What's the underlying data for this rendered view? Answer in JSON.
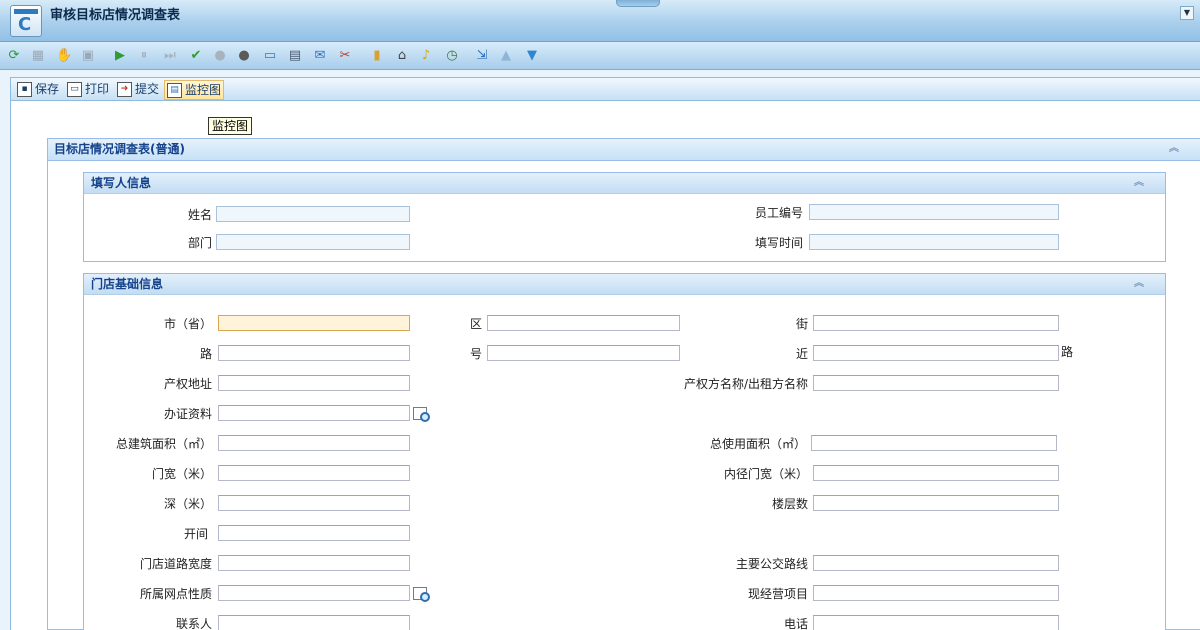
{
  "window": {
    "title": "审核目标店情况调查表",
    "menu_arrow": "▼"
  },
  "iconbar": {
    "icons": [
      {
        "name": "refresh-icon",
        "glyph": "⟳",
        "color": "#2b9a3a"
      },
      {
        "name": "grid-icon",
        "glyph": "▦",
        "color": "#9aa9b8"
      },
      {
        "name": "thumbs-down-icon",
        "glyph": "✋",
        "color": "#d08a1c"
      },
      {
        "name": "window-icon",
        "glyph": "▣",
        "color": "#9aa9b8"
      },
      {
        "name": "play-icon",
        "glyph": "▶",
        "color": "#2f9a36"
      },
      {
        "name": "pause-icon",
        "glyph": "⏸",
        "color": "#a7b2be"
      },
      {
        "name": "skip-icon",
        "glyph": "⏭",
        "color": "#a7b2be"
      },
      {
        "name": "approve-icon",
        "glyph": "✔",
        "color": "#2d9d2d"
      },
      {
        "name": "stop-icon",
        "glyph": "●",
        "color": "#a7b2be"
      },
      {
        "name": "record-icon",
        "glyph": "●",
        "color": "#5a5a5a"
      },
      {
        "name": "comment-icon",
        "glyph": "▭",
        "color": "#3b76b6"
      },
      {
        "name": "print-doc-icon",
        "glyph": "▤",
        "color": "#4a5c70"
      },
      {
        "name": "mail-forward-icon",
        "glyph": "✉",
        "color": "#2f74bb"
      },
      {
        "name": "tools-icon",
        "glyph": "✂",
        "color": "#c0392b"
      },
      {
        "name": "clipboard-icon",
        "glyph": "▮",
        "color": "#d6a231"
      },
      {
        "name": "attachment-icon",
        "glyph": "⌂",
        "color": "#444"
      },
      {
        "name": "bell-icon",
        "glyph": "♪",
        "color": "#e0a400"
      },
      {
        "name": "history-icon",
        "glyph": "◷",
        "color": "#3c7a3c"
      },
      {
        "name": "export-icon",
        "glyph": "⇲",
        "color": "#2f74bb"
      },
      {
        "name": "arrow-up-icon",
        "glyph": "▲",
        "color": "#8fb4d6"
      },
      {
        "name": "arrow-down-icon",
        "glyph": "▼",
        "color": "#2f86d0"
      }
    ]
  },
  "actions": {
    "save": "保存",
    "print": "打印",
    "submit": "提交",
    "monitor": "监控图",
    "tooltip": "监控图"
  },
  "form": {
    "title": "目标店情况调查表(普通)",
    "collapse_glyph": "︽",
    "filler": {
      "title": "填写人信息",
      "name_label": "姓名",
      "name_value": "",
      "dept_label": "部门",
      "dept_value": "",
      "emp_no_label": "员工编号",
      "emp_no_value": "",
      "time_label": "填写时间",
      "time_value": ""
    },
    "store": {
      "title": "门店基础信息",
      "city_label": "市（省）",
      "district_label": "区",
      "street_label": "街",
      "road_label": "路",
      "number_label": "号",
      "near_label": "近",
      "near_suffix": "路",
      "property_addr_label": "产权地址",
      "owner_name_label": "产权方名称/出租方名称",
      "certificate_label": "办证资料",
      "total_area_label": "总建筑面积（㎡）",
      "usable_area_label": "总使用面积（㎡）",
      "door_width_label": "门宽（米）",
      "inner_door_width_label": "内径门宽（米）",
      "depth_label": "深（米）",
      "floors_label": "楼层数",
      "bays_label": "开间",
      "road_width_label": "门店道路宽度",
      "bus_routes_label": "主要公交路线",
      "outlet_type_label": "所属网点性质",
      "current_business_label": "现经营项目",
      "contact_label": "联系人",
      "phone_label": "电话"
    }
  }
}
